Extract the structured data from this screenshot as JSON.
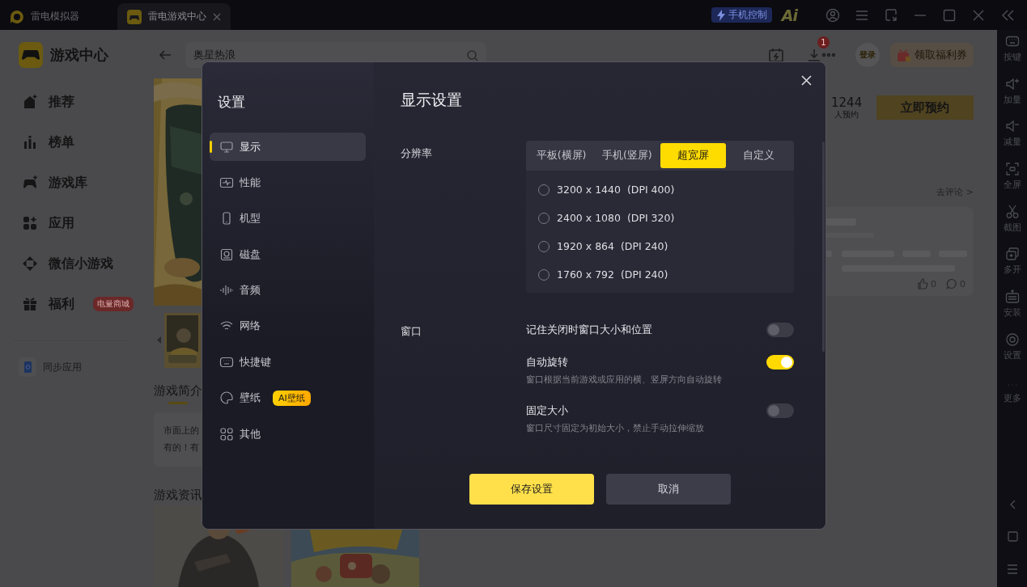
{
  "title_bar": {
    "tabs": [
      {
        "label": "雷电模拟器",
        "selected": false,
        "closable": false
      },
      {
        "label": "雷电游戏中心",
        "selected": true,
        "closable": true
      }
    ],
    "phone_control": "手机控制",
    "ai_logo": "Ai"
  },
  "sidebar": {
    "title": "游戏中心",
    "items": [
      {
        "label": "推荐"
      },
      {
        "label": "榜单"
      },
      {
        "label": "游戏库"
      },
      {
        "label": "应用"
      },
      {
        "label": "微信小游戏"
      },
      {
        "label": "福利",
        "badge": "电量商城"
      }
    ],
    "sync": "同步应用"
  },
  "header": {
    "search": {
      "value": "奥星热浪"
    },
    "download_badge": "1",
    "login": "登录",
    "coupon": "领取福利券"
  },
  "game": {
    "intro_heading": "游戏简介",
    "intro_lines": [
      "市面上的",
      "有的！有"
    ],
    "news_heading": "游戏资讯",
    "reserve_count": "1244",
    "reserve_label": "人预约",
    "reserve_button": "立即预约",
    "comment_link": "去评论 >",
    "comment": {
      "likes": "0",
      "replies": "0"
    }
  },
  "toolbar": {
    "items": [
      "按键",
      "加量",
      "减量",
      "全屏",
      "截图",
      "多开",
      "安装",
      "设置",
      "更多"
    ]
  },
  "settings_dialog": {
    "title": "设置",
    "nav": [
      {
        "label": "显示",
        "selected": true
      },
      {
        "label": "性能",
        "selected": false
      },
      {
        "label": "机型",
        "selected": false
      },
      {
        "label": "磁盘",
        "selected": false
      },
      {
        "label": "音频",
        "selected": false
      },
      {
        "label": "网络",
        "selected": false
      },
      {
        "label": "快捷键",
        "selected": false
      },
      {
        "label": "壁纸",
        "selected": false,
        "badge": "AI壁纸"
      },
      {
        "label": "其他",
        "selected": false
      }
    ],
    "heading": "显示设置",
    "resolution": {
      "label": "分辨率",
      "modes": [
        {
          "label": "平板(横屏)",
          "selected": false
        },
        {
          "label": "手机(竖屏)",
          "selected": false
        },
        {
          "label": "超宽屏",
          "selected": true
        },
        {
          "label": "自定义",
          "selected": false
        }
      ],
      "options": [
        {
          "size": "3200 x 1440",
          "dpi": "(DPI 400)",
          "selected": false
        },
        {
          "size": "2400 x 1080",
          "dpi": "(DPI 320)",
          "selected": false
        },
        {
          "size": "1920 x 864",
          "dpi": "(DPI 240)",
          "selected": false
        },
        {
          "size": "1760 x 792",
          "dpi": "(DPI 240)",
          "selected": false
        }
      ]
    },
    "window": {
      "label": "窗口",
      "toggles": [
        {
          "label": "记住关闭时窗口大小和位置",
          "on": false
        },
        {
          "label": "自动旋转",
          "on": true,
          "description": "窗口根据当前游戏或应用的横、竖屏方向自动旋转"
        },
        {
          "label": "固定大小",
          "on": false,
          "description": "窗口尺寸固定为初始大小，禁止手动拉伸缩放"
        }
      ]
    },
    "buttons": {
      "save": "保存设置",
      "cancel": "取消"
    }
  }
}
